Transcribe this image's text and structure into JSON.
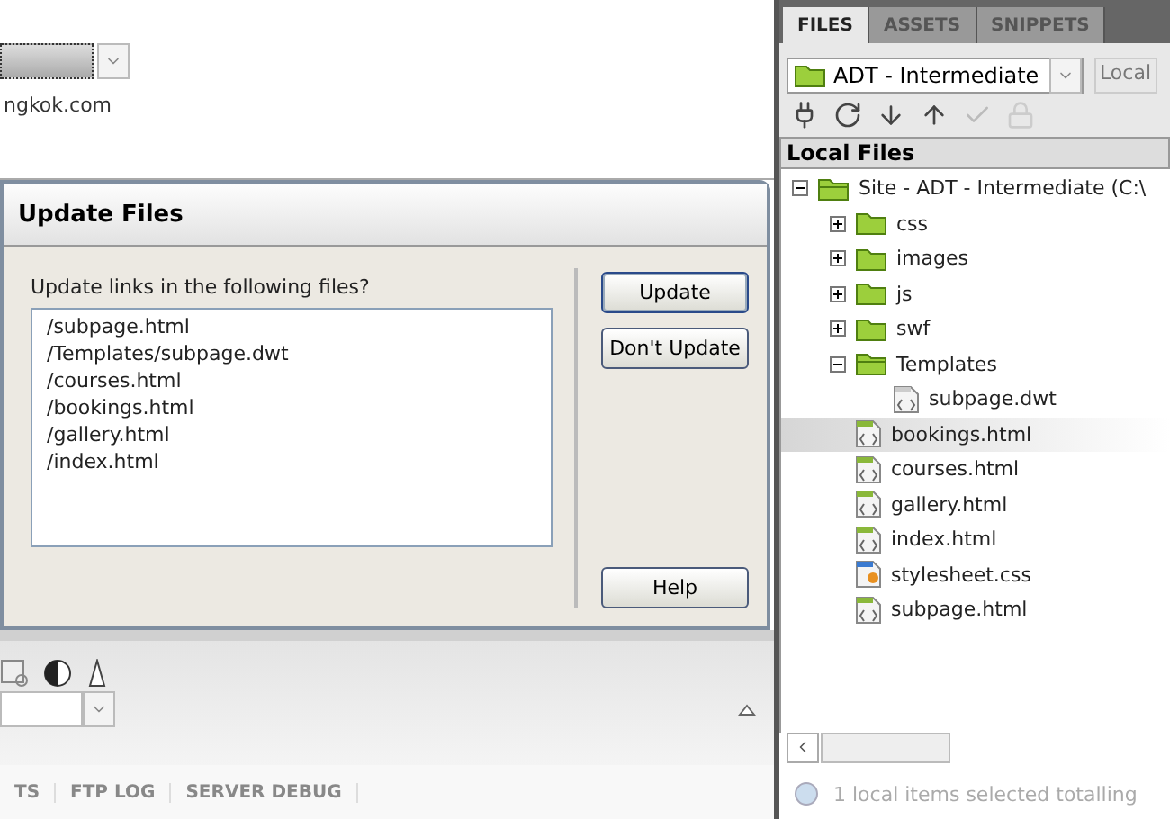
{
  "page_settings": {
    "url_text": "ngkok.com"
  },
  "dialog": {
    "title": "Update Files",
    "prompt": "Update links in the following files?",
    "files": [
      "/subpage.html",
      "/Templates/subpage.dwt",
      "/courses.html",
      "/bookings.html",
      "/gallery.html",
      "/index.html"
    ],
    "buttons": [
      {
        "label": "Update",
        "default": true
      },
      {
        "label": "Don't Update",
        "default": false
      },
      {
        "label": "Help",
        "default": false
      }
    ]
  },
  "bottom_panel": {
    "tabs": [
      "TS",
      "FTP LOG",
      "SERVER DEBUG"
    ]
  },
  "files_panel": {
    "tabs": [
      {
        "label": "FILES",
        "selected": true
      },
      {
        "label": "ASSETS",
        "selected": false
      },
      {
        "label": "SNIPPETS",
        "selected": false
      }
    ],
    "site": "ADT - Intermediate",
    "view": "Local",
    "header": "Local Files",
    "tree": [
      {
        "label": "Site - ADT - Intermediate (C:\\",
        "kind": "site",
        "expanded": true,
        "selected": false,
        "children": [
          {
            "label": "css",
            "kind": "folder",
            "expanded": false,
            "selected": false
          },
          {
            "label": "images",
            "kind": "folder",
            "expanded": false,
            "selected": false
          },
          {
            "label": "js",
            "kind": "folder",
            "expanded": false,
            "selected": false
          },
          {
            "label": "swf",
            "kind": "folder",
            "expanded": false,
            "selected": false
          },
          {
            "label": "Templates",
            "kind": "folder",
            "expanded": true,
            "selected": false,
            "children": [
              {
                "label": "subpage.dwt",
                "kind": "template",
                "selected": false
              }
            ]
          },
          {
            "label": "bookings.html",
            "kind": "html",
            "selected": true
          },
          {
            "label": "courses.html",
            "kind": "html",
            "selected": false
          },
          {
            "label": "gallery.html",
            "kind": "html",
            "selected": false
          },
          {
            "label": "index.html",
            "kind": "html",
            "selected": false
          },
          {
            "label": "stylesheet.css",
            "kind": "css",
            "selected": false
          },
          {
            "label": "subpage.html",
            "kind": "html",
            "selected": false
          }
        ]
      }
    ],
    "status": "1 local items selected totalling"
  }
}
